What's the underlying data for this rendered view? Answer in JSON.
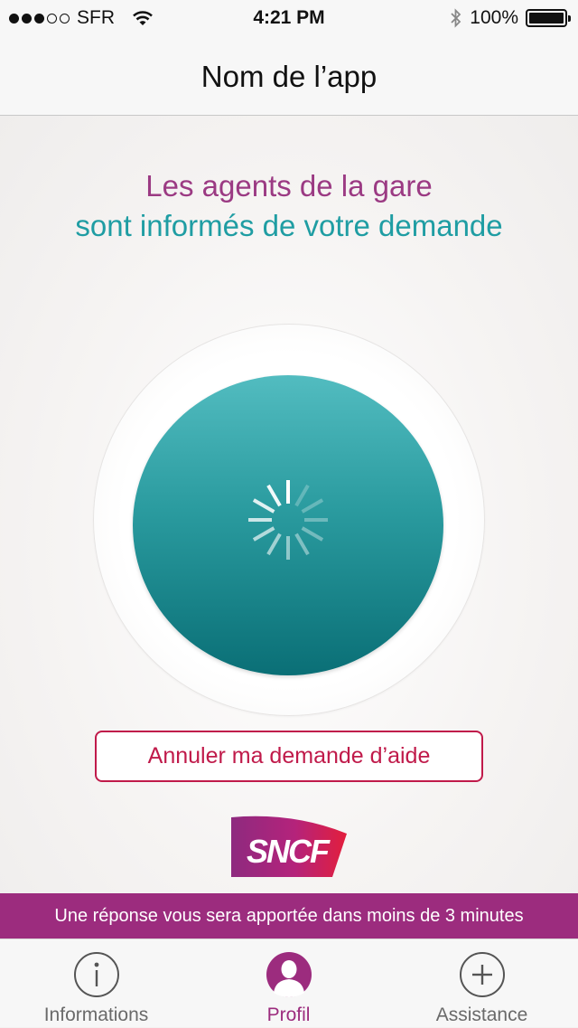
{
  "status_bar": {
    "carrier": "SFR",
    "time": "4:21 PM",
    "battery": "100%",
    "signal_bars_filled": 3,
    "signal_bars_total": 5
  },
  "nav": {
    "title": "Nom de l’app"
  },
  "main": {
    "headline_line1": "Les agents de la gare",
    "headline_line2": "sont informés de votre demande",
    "cancel_label": "Annuler ma demande d’aide",
    "logo_text": "SNCF"
  },
  "banner": {
    "text": "Une réponse vous sera apportée dans moins de 3 minutes"
  },
  "tabs": [
    {
      "label": "Informations",
      "icon": "info-icon",
      "active": false
    },
    {
      "label": "Profil",
      "icon": "profile-icon",
      "active": true
    },
    {
      "label": "Assistance",
      "icon": "plus-icon",
      "active": false
    }
  ],
  "colors": {
    "brand_purple": "#9c2c7e",
    "teal": "#1f9da3",
    "cancel_red": "#c01a4a"
  }
}
